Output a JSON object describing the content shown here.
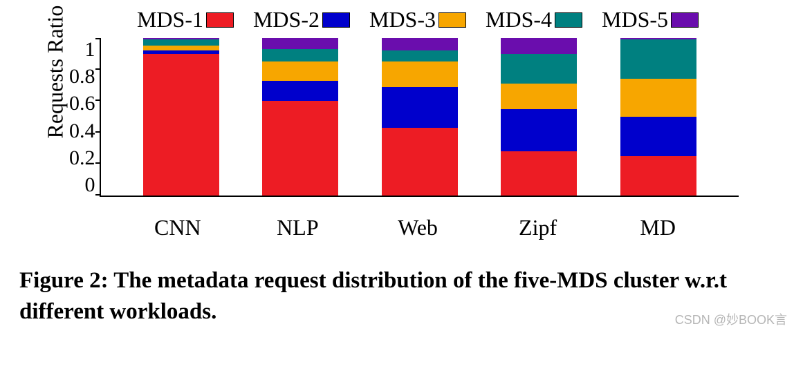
{
  "legend": {
    "items": [
      {
        "label": "MDS-1",
        "color": "#ed1c24"
      },
      {
        "label": "MDS-2",
        "color": "#0000cc"
      },
      {
        "label": "MDS-3",
        "color": "#f7a600"
      },
      {
        "label": "MDS-4",
        "color": "#008080"
      },
      {
        "label": "MDS-5",
        "color": "#6a0dad"
      }
    ]
  },
  "chart_data": {
    "type": "bar",
    "stacked": true,
    "categories": [
      "CNN",
      "NLP",
      "Web",
      "Zipf",
      "MD"
    ],
    "series": [
      {
        "name": "MDS-1",
        "values": [
          0.9,
          0.6,
          0.43,
          0.28,
          0.25
        ]
      },
      {
        "name": "MDS-2",
        "values": [
          0.02,
          0.13,
          0.26,
          0.27,
          0.25
        ]
      },
      {
        "name": "MDS-3",
        "values": [
          0.03,
          0.12,
          0.16,
          0.16,
          0.24
        ]
      },
      {
        "name": "MDS-4",
        "values": [
          0.04,
          0.08,
          0.07,
          0.19,
          0.25
        ]
      },
      {
        "name": "MDS-5",
        "values": [
          0.01,
          0.07,
          0.08,
          0.1,
          0.01
        ]
      }
    ],
    "ylabel": "Requests Ratio",
    "xlabel": "",
    "ylim": [
      0,
      1
    ],
    "yticks": [
      0,
      0.2,
      0.4,
      0.6,
      0.8,
      1
    ],
    "ytick_labels": [
      "0",
      "0.2",
      "0.4",
      "0.6",
      "0.8",
      "1"
    ]
  },
  "caption": "Figure 2: The metadata request distribution of the five-MDS cluster w.r.t different workloads.",
  "watermark": "CSDN @妙BOOK言"
}
